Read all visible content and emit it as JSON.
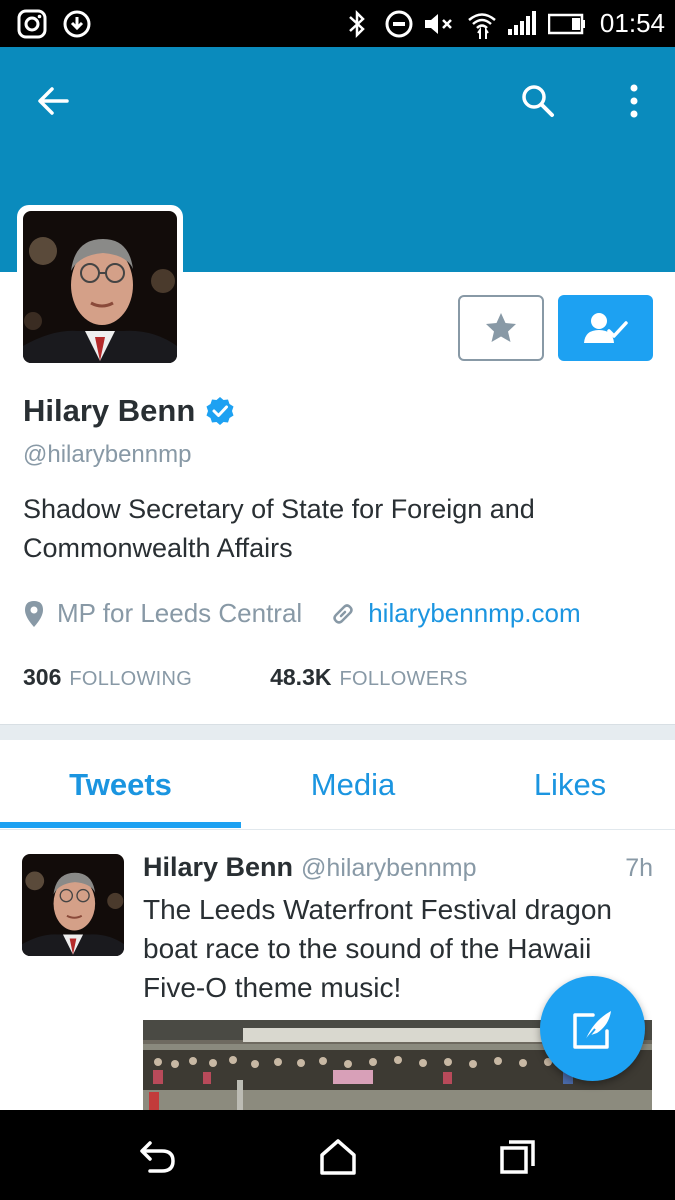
{
  "status_bar": {
    "time": "01:54",
    "icons": [
      "instagram-icon",
      "download-icon",
      "bluetooth-icon",
      "do-not-disturb-icon",
      "muted-volume-icon",
      "wifi-icon",
      "cellular-signal-icon",
      "battery-icon"
    ]
  },
  "header": {
    "icons": [
      "back-arrow-icon",
      "search-icon",
      "more-vertical-icon"
    ],
    "color": "#0a8bbd"
  },
  "profile": {
    "display_name": "Hilary Benn",
    "verified": true,
    "handle": "@hilarybennmp",
    "bio": "Shadow Secretary of State for Foreign and Commonwealth Affairs",
    "location": "MP for Leeds Central",
    "url": "hilarybennmp.com",
    "following_count": "306",
    "following_label": "FOLLOWING",
    "followers_count": "48.3K",
    "followers_label": "FOLLOWERS",
    "buttons": [
      "star-icon",
      "following-person-check-icon"
    ]
  },
  "tabs": [
    {
      "label": "Tweets",
      "active": true
    },
    {
      "label": "Media",
      "active": false
    },
    {
      "label": "Likes",
      "active": false
    }
  ],
  "tweet": {
    "name": "Hilary Benn",
    "handle": "@hilarybennmp",
    "time": "7h",
    "text": "The Leeds Waterfront Festival dragon boat race to the sound of the Hawaii Five-O theme music!"
  },
  "nav_bar": {
    "icons": [
      "back-nav-icon",
      "home-nav-icon",
      "recents-nav-icon"
    ]
  },
  "colors": {
    "accent": "#1da1f2",
    "link": "#1b95e0",
    "muted_text": "#8899a6"
  }
}
